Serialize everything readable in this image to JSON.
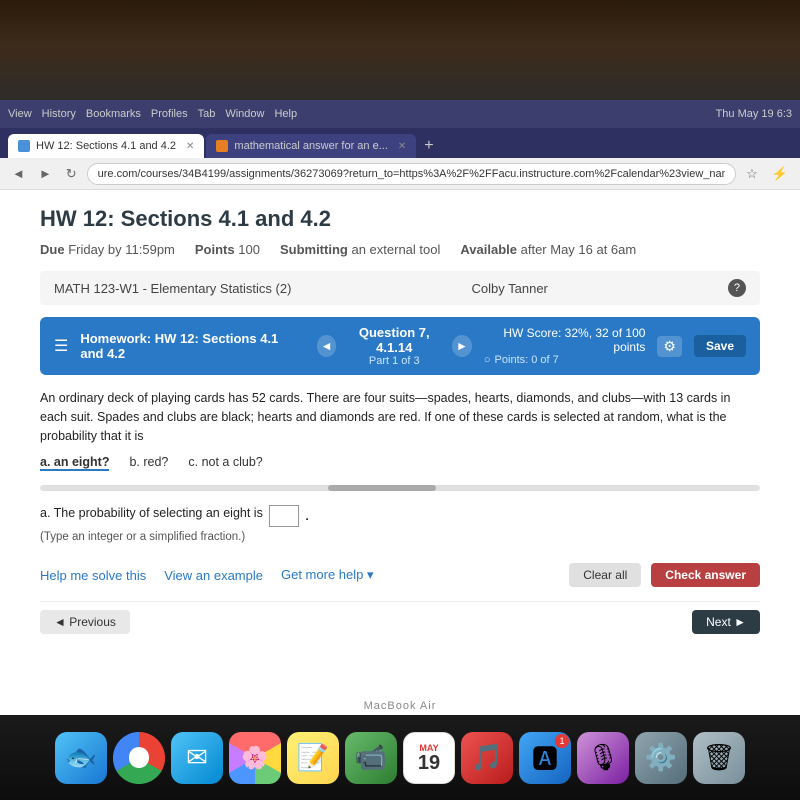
{
  "desktop": {
    "macbook_label": "MacBook Air"
  },
  "browser": {
    "menu_items": [
      "View",
      "History",
      "Bookmarks",
      "Profiles",
      "Tab",
      "Window",
      "Help"
    ],
    "clock": "Thu May 19  6:3",
    "tabs": [
      {
        "id": "tab1",
        "label": "HW 12: Sections 4.1 and 4.2",
        "active": true,
        "favicon": "hw"
      },
      {
        "id": "tab2",
        "label": "mathematical answer for an e...",
        "active": false,
        "favicon": "math"
      }
    ],
    "address": "ure.com/courses/34B4199/assignments/36273069?return_to=https%3A%2F%2FFacu.instructure.com%2Fcalendar%23view_name%3Dmonth%26view..."
  },
  "page": {
    "title": "HW 12: Sections 4.1 and 4.2",
    "due": "Friday by 11:59pm",
    "points": "100",
    "submitting": "an external tool",
    "available": "after May 16 at 6am",
    "course": "MATH 123-W1 - Elementary Statistics (2)",
    "user": "Colby Tanner",
    "homework_label": "Homework: HW 12: Sections 4.1 and 4.2",
    "question_title": "Question 7, 4.1.14",
    "question_sub": "Part 1 of 3",
    "hw_score": "HW Score: 32%, 32 of 100 points",
    "points_label": "Points: 0 of 7",
    "save_btn": "Save",
    "question_text": "An ordinary deck of playing cards has 52 cards. There are four suits—spades, hearts, diamonds, and clubs—with 13 cards in each suit. Spades and clubs are black; hearts and diamonds are red. If one of these cards is selected at random, what is the probability that it is",
    "parts": [
      {
        "label": "a. an eight?",
        "active": true
      },
      {
        "label": "b. red?",
        "active": false
      },
      {
        "label": "c. not a club?",
        "active": false
      }
    ],
    "answer_label": "a. The probability of selecting an eight is",
    "answer_hint": "(Type an integer or a simplified fraction.)",
    "help_btn": "Help me solve this",
    "example_btn": "View an example",
    "more_help_btn": "Get more help ▾",
    "clear_btn": "Clear all",
    "check_btn": "Check answer",
    "prev_btn": "◄ Previous",
    "next_btn": "Next ►"
  },
  "dock": {
    "icons": [
      {
        "name": "finder",
        "class": "finder",
        "emoji": "🔍",
        "badge": null
      },
      {
        "name": "chrome",
        "class": "chrome",
        "emoji": "",
        "badge": null
      },
      {
        "name": "mail",
        "class": "mail",
        "emoji": "✉️",
        "badge": null
      },
      {
        "name": "photos",
        "class": "photos",
        "emoji": "🌸",
        "badge": null
      },
      {
        "name": "notes",
        "class": "notes",
        "emoji": "📝",
        "badge": null
      },
      {
        "name": "facetime",
        "class": "facetime",
        "emoji": "📹",
        "badge": null
      },
      {
        "name": "calendar",
        "class": "calendar",
        "month": "MAY",
        "day": "19",
        "badge": null
      },
      {
        "name": "music",
        "class": "music",
        "emoji": "🎵",
        "badge": null
      },
      {
        "name": "appstore",
        "class": "appstore",
        "emoji": "🅰",
        "badge": "1"
      },
      {
        "name": "podcast",
        "class": "podcast",
        "emoji": "🎙",
        "badge": null
      },
      {
        "name": "settings",
        "class": "settings",
        "emoji": "⚙️",
        "badge": null
      },
      {
        "name": "trash",
        "class": "trash",
        "emoji": "🗑",
        "badge": null
      }
    ]
  }
}
